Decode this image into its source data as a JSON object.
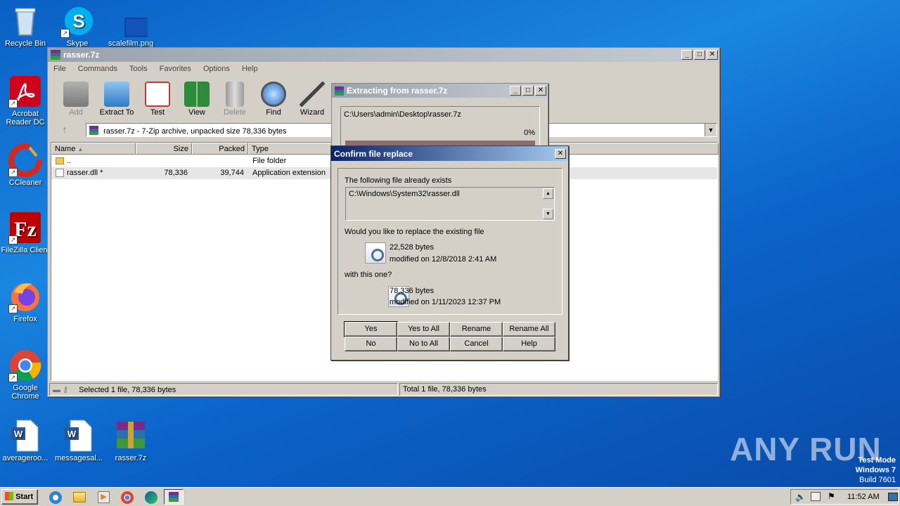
{
  "desktop": {
    "icons": [
      {
        "label": "Recycle Bin",
        "icon": "recycle-bin-icon"
      },
      {
        "label": "Skype",
        "icon": "skype-icon"
      },
      {
        "label": "scalefilm.png",
        "icon": "image-file-icon"
      },
      {
        "label": "Acrobat Reader DC",
        "icon": "acrobat-icon"
      },
      {
        "label": "CCleaner",
        "icon": "ccleaner-icon"
      },
      {
        "label": "FileZilla Client",
        "icon": "filezilla-icon"
      },
      {
        "label": "Firefox",
        "icon": "firefox-icon"
      },
      {
        "label": "Google Chrome",
        "icon": "chrome-icon"
      },
      {
        "label": "averageroo...",
        "icon": "word-doc-icon"
      },
      {
        "label": "messagesal...",
        "icon": "word-doc-icon"
      },
      {
        "label": "rasser.7z",
        "icon": "winrar-archive-icon"
      }
    ],
    "watermark": "ANY RUN",
    "test_mode": [
      "Test Mode",
      "Windows 7",
      "Build 7601"
    ]
  },
  "winrar": {
    "title": "rasser.7z",
    "menu": [
      "File",
      "Commands",
      "Tools",
      "Favorites",
      "Options",
      "Help"
    ],
    "toolbar": [
      "Add",
      "Extract To",
      "Test",
      "View",
      "Delete",
      "Find",
      "Wizard"
    ],
    "address": "rasser.7z - 7-Zip archive, unpacked size 78,336 bytes",
    "columns": [
      "Name",
      "Size",
      "Packed",
      "Type"
    ],
    "rows": [
      {
        "name": "..",
        "size": "",
        "packed": "",
        "type": "File folder"
      },
      {
        "name": "rasser.dll *",
        "size": "78,336",
        "packed": "39,744",
        "type": "Application extension"
      }
    ],
    "status_left": "Selected 1 file, 78,336 bytes",
    "status_right": "Total 1 file, 78,336 bytes"
  },
  "extracting": {
    "title": "Extracting from rasser.7z",
    "path": "C:\\Users\\admin\\Desktop\\rasser.7z",
    "percent": "0%"
  },
  "confirm": {
    "title": "Confirm file replace",
    "exists_label": "The following file already exists",
    "existing_path": "C:\\Windows\\System32\\rasser.dll",
    "question": "Would you like to replace the existing file",
    "old_size": "22,528 bytes",
    "old_modified": "modified on 12/8/2018 2:41 AM",
    "with_label": "with this one?",
    "new_size": "78,336 bytes",
    "new_modified": "modified on 1/11/2023 12:37 PM",
    "buttons": [
      "Yes",
      "Yes to All",
      "Rename",
      "Rename All",
      "No",
      "No to All",
      "Cancel",
      "Help"
    ]
  },
  "taskbar": {
    "start": "Start",
    "time": "11:52 AM"
  }
}
